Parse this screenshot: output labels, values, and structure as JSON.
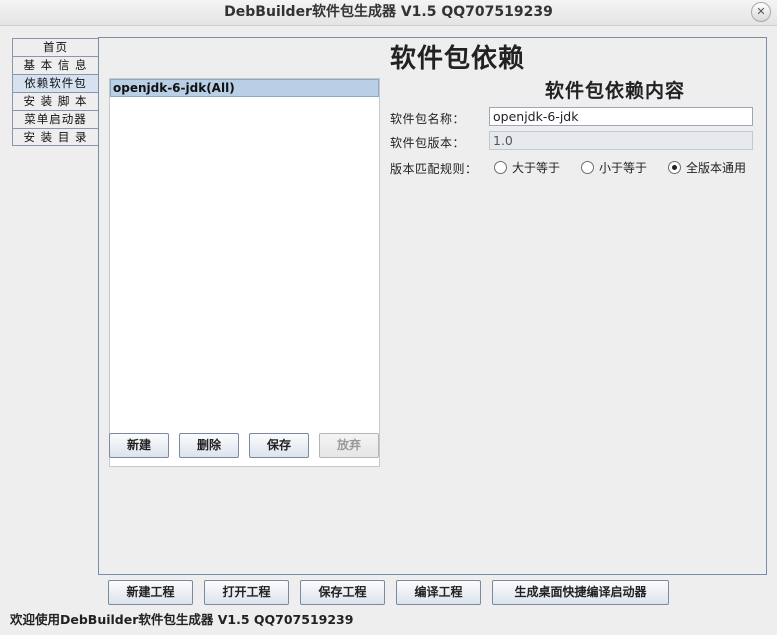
{
  "window": {
    "title": "DebBuilder软件包生成器 V1.5 QQ707519239",
    "close_symbol": "✕"
  },
  "tabs": [
    {
      "label": "首页"
    },
    {
      "label": "基 本 信 息"
    },
    {
      "label": "依赖软件包"
    },
    {
      "label": "安 装 脚 本"
    },
    {
      "label": "菜单启动器"
    },
    {
      "label": "安 装 目 录"
    }
  ],
  "dependency_list": {
    "items": [
      "openjdk-6-jdk(All)"
    ]
  },
  "list_buttons": {
    "new": "新建",
    "delete": "删除",
    "save": "保存",
    "discard": "放弃"
  },
  "section": {
    "title": "软件包依赖",
    "subtitle": "软件包依赖内容"
  },
  "form": {
    "name_label": "软件包名称：",
    "name_value": "openjdk-6-jdk",
    "version_label": "软件包版本：",
    "version_value": "1.0",
    "rule_label": "版本匹配规则：",
    "rules": [
      {
        "label": "大于等于",
        "checked": false
      },
      {
        "label": "小于等于",
        "checked": false
      },
      {
        "label": "全版本通用",
        "checked": true
      }
    ]
  },
  "project_buttons": {
    "new_project": "新建工程",
    "open_project": "打开工程",
    "save_project": "保存工程",
    "compile_project": "编译工程",
    "desktop_launcher": "生成桌面快捷编译启动器"
  },
  "status_bar": {
    "text": "欢迎使用DebBuilder软件包生成器 V1.5 QQ707519239"
  }
}
